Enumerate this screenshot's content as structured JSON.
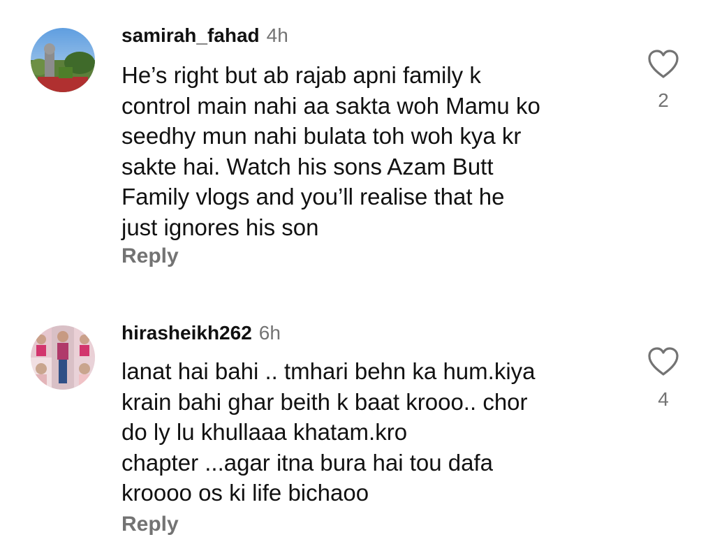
{
  "comments": [
    {
      "username": "samirah_fahad",
      "time": "4h",
      "lines": [
        "He’s right but ab rajab apni family k",
        "control main nahi aa sakta woh Mamu ko",
        "seedhy mun nahi bulata toh woh kya kr",
        "sakte hai. Watch his sons Azam Butt",
        "Family vlogs and you’ll realise that he",
        "just ignores his son"
      ],
      "likes": "2",
      "reply_label": "Reply",
      "avatar_icon": "landscape-photo-avatar"
    },
    {
      "username": "hirasheikh262",
      "time": "6h",
      "lines": [
        "lanat hai bahi .. tmhari behn ka hum.kiya",
        "krain bahi ghar beith k baat krooo.. chor",
        "do ly lu khullaaa khatam.kro",
        "chapter ...agar itna bura hai tou dafa",
        "kroooo os ki life bichaoo"
      ],
      "likes": "4",
      "reply_label": "Reply",
      "avatar_icon": "children-collage-avatar"
    }
  ],
  "icons": {
    "like": "heart-outline-icon"
  },
  "colors": {
    "text": "#111111",
    "muted": "#737373",
    "background": "#ffffff"
  }
}
